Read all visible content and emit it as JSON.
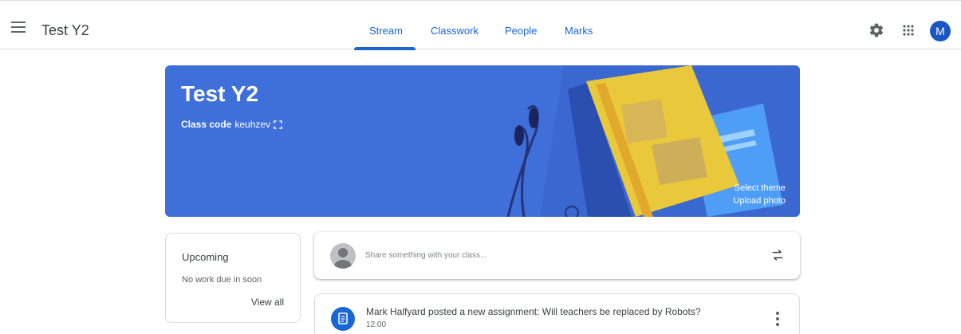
{
  "header": {
    "class_title": "Test Y2",
    "tabs": [
      {
        "label": "Stream",
        "active": true
      },
      {
        "label": "Classwork",
        "active": false
      },
      {
        "label": "People",
        "active": false
      },
      {
        "label": "Marks",
        "active": false
      }
    ],
    "avatar_letter": "M",
    "icons": [
      "menu-icon",
      "settings-icon",
      "apps-grid-icon"
    ]
  },
  "banner": {
    "title": "Test Y2",
    "class_code_label": "Class code",
    "class_code_value": "keuhzev",
    "select_theme": "Select theme",
    "upload_photo": "Upload photo",
    "background_color": "#3f6fd8"
  },
  "upcoming": {
    "title": "Upcoming",
    "empty_text": "No work due in soon",
    "view_all": "View all"
  },
  "share": {
    "placeholder": "Share something with your class..."
  },
  "posts": [
    {
      "title": "Mark Halfyard posted a new assignment: Will teachers be replaced by Robots?",
      "time": "12:00"
    }
  ],
  "colors": {
    "accent": "#1967d2",
    "banner": "#3f6fd8"
  }
}
